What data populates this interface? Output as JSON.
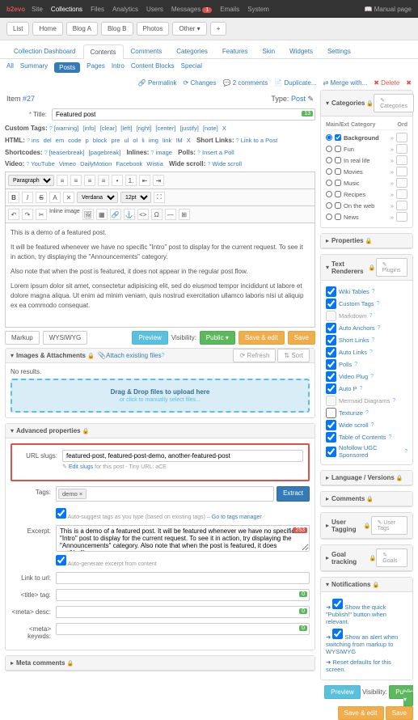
{
  "topbar": {
    "brand": "b2evo",
    "items": [
      "Site",
      "Collections",
      "Files",
      "Analytics",
      "Users",
      "Messages",
      "Emails",
      "System"
    ],
    "msg_badge": "1",
    "manual": "Manual page"
  },
  "subnav": [
    "List",
    "Home",
    "Blog A",
    "Blog B",
    "Photos",
    "Other"
  ],
  "tabs1": [
    "Collection Dashboard",
    "Contents",
    "Comments",
    "Categories",
    "Features",
    "Skin",
    "Widgets",
    "Settings"
  ],
  "tabs2": [
    "All",
    "Summary",
    "Posts",
    "Pages",
    "Intro",
    "Content Blocks",
    "Special"
  ],
  "actions": {
    "permalink": "Permalink",
    "changes": "Changes",
    "comments": "2 comments",
    "duplicate": "Duplicate...",
    "merge": "Merge with...",
    "delete": "Delete"
  },
  "item": {
    "label": "Item",
    "num": "#27",
    "type_lbl": "Type:",
    "type": "Post"
  },
  "title": {
    "lbl": "Title:",
    "val": "Featured post",
    "cnt": "13"
  },
  "tagrows": {
    "custom": {
      "lbl": "Custom Tags:",
      "tags": [
        "[warning]",
        "[info]",
        "[clear]",
        "[left]",
        "[right]",
        "[center]",
        "[justify]",
        "[note]",
        "X"
      ]
    },
    "html": {
      "lbl": "HTML:",
      "tags": [
        "ins",
        "del",
        "em",
        "code",
        "p",
        "block",
        "pre",
        "ul",
        "ol",
        "li",
        "img",
        "link",
        "!M",
        "X"
      ],
      "extra_lbl": "Short Links:",
      "extra": "Link to a Post"
    },
    "short": {
      "lbl": "Shortcodes:",
      "tags": [
        "[teaserbreak]",
        "[pagebreak]"
      ],
      "inlines_lbl": "Inlines:",
      "inlines": "image",
      "polls_lbl": "Polls:",
      "polls": "Insert a Poll"
    },
    "video": {
      "lbl": "Video:",
      "tags": [
        "YouTube",
        "Vimeo",
        "DailyMotion",
        "Facebook",
        "Wistia"
      ],
      "ws_lbl": "Wide scroll:",
      "ws": "Wide scroll"
    }
  },
  "toolbar": {
    "para": "Paragraph",
    "font": "Verdana",
    "size": "12pt"
  },
  "content": {
    "p1": "This is a demo of a featured post.",
    "p2": "It will be featured whenever we have no specific \"Intro\" post to display for the current request. To see it in action, try displaying the \"Announcements\" category.",
    "p3": "Also note that when the post is featured, it does not appear in the regular post flow.",
    "p4": "Lorem ipsum dolor sit amet, consectetur adipisicing elit, sed do eiusmod tempor incididunt ut labore et dolore magna aliqua. Ut enim ad minim veniam, quis nostrud exercitation ullamco laboris nisi ut aliquip ex ea commodo consequat."
  },
  "edfoot": {
    "markup": "Markup",
    "wys": "WYSIWYG",
    "preview": "Preview",
    "vis": "Visibility:",
    "public": "Public",
    "save_edit": "Save & edit",
    "save": "Save"
  },
  "attach": {
    "title": "Images & Attachments",
    "attach_link": "Attach existing files",
    "refresh": "Refresh",
    "sort": "Sort",
    "nores": "No results.",
    "drop": "Drag & Drop files to upload here",
    "drop2": "or click to manually select files..."
  },
  "adv": {
    "title": "Advanced properties"
  },
  "slugs": {
    "lbl": "URL slugs:",
    "val": "featured-post, featured-post-demo, another-featured-post",
    "edit": "Edit slugs",
    "hint": "for this post - Tiny URL: aCE"
  },
  "tags": {
    "lbl": "Tags:",
    "val": "demo",
    "extract": "Extract",
    "hint": "Auto-suggest tags as you type (based on existing tags) –",
    "mgr": "Go to tags manager"
  },
  "excerpt": {
    "lbl": "Excerpt:",
    "val": "This is a demo of a featured post. It will be featured whenever we have no specific \"Intro\" post to display for the current request. To see it in action, try displaying the \"Announcements\" category. Also note that when the post is featured, it does not&hellip;",
    "cnt": "253",
    "auto": "Auto-generate excerpt from content"
  },
  "link": {
    "lbl": "Link to url:"
  },
  "titletag": {
    "lbl": "<title> tag:",
    "cnt": "0"
  },
  "metadesc": {
    "lbl": "<meta> desc:",
    "cnt": "0"
  },
  "metakey": {
    "lbl": "<meta> keywds:",
    "cnt": "0"
  },
  "metacomments": {
    "title": "Meta comments"
  },
  "cats": {
    "title": "Categories",
    "btn": "Categories",
    "hdr": {
      "main": "Main/Ext",
      "cat": "Category",
      "ord": "Ord"
    },
    "items": [
      {
        "name": "Background",
        "sel": true,
        "bold": true
      },
      {
        "name": "Fun"
      },
      {
        "name": "In real life"
      },
      {
        "name": "Movies"
      },
      {
        "name": "Music"
      },
      {
        "name": "Recipes"
      },
      {
        "name": "On the web"
      },
      {
        "name": "News"
      }
    ]
  },
  "props": {
    "title": "Properties"
  },
  "rend": {
    "title": "Text Renderers",
    "btn": "Plugins",
    "items": [
      {
        "n": "Wiki Tables",
        "on": true
      },
      {
        "n": "Custom Tags",
        "on": true
      },
      {
        "n": "Markdown",
        "on": false,
        "dis": true
      },
      {
        "n": "Auto Anchors",
        "on": true
      },
      {
        "n": "Short Links",
        "on": true
      },
      {
        "n": "Auto Links",
        "on": true
      },
      {
        "n": "Polls",
        "on": true
      },
      {
        "n": "Video Plug",
        "on": true
      },
      {
        "n": "Auto P",
        "on": true
      },
      {
        "n": "Mermaid Diagrams",
        "on": false,
        "dis": true
      },
      {
        "n": "Texturize",
        "on": false
      },
      {
        "n": "Wide scroll",
        "on": true
      },
      {
        "n": "Table of Contents",
        "on": true
      },
      {
        "n": "Nofollow UGC Sponsored",
        "on": true
      }
    ]
  },
  "lang": {
    "title": "Language / Versions"
  },
  "comm": {
    "title": "Comments"
  },
  "utag": {
    "title": "User Tagging",
    "btn": "User Tags"
  },
  "goal": {
    "title": "Goal tracking",
    "btn": "Goals"
  },
  "notif": {
    "title": "Notifications",
    "m1": "Show the quick \"Publish!\" button when relevant.",
    "m2": "Show an alert when switching from markup to WYSIWYG",
    "m3": "Reset defaults for this screen."
  }
}
